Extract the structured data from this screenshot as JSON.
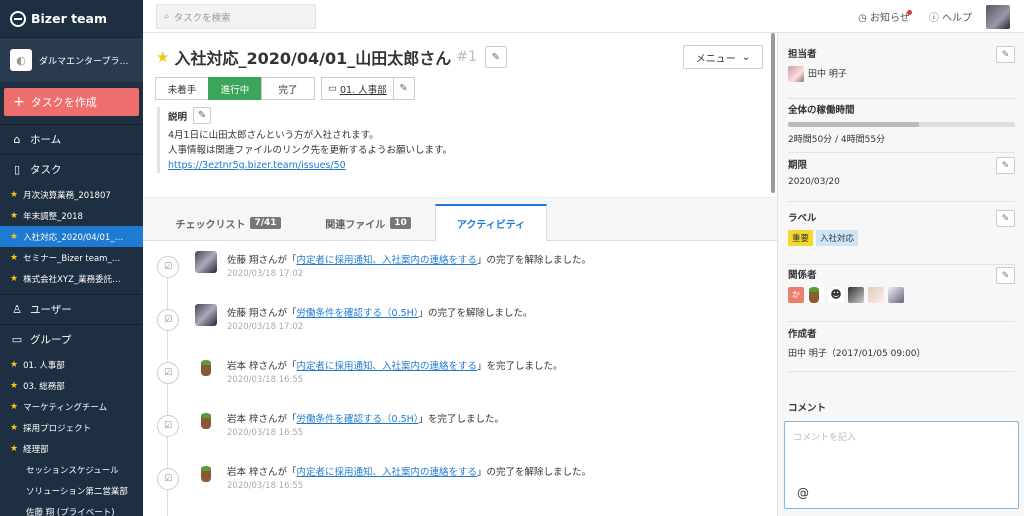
{
  "app": {
    "brand": "Bizer team",
    "org_name": "ダルマエンタープラ…"
  },
  "sidebar": {
    "create_label": "タスクを作成",
    "home_label": "ホーム",
    "tasks_label": "タスク",
    "tasks": [
      {
        "label": "月次決算業務_201807",
        "active": false
      },
      {
        "label": "年末調整_2018",
        "active": false
      },
      {
        "label": "入社対応_2020/04/01_…",
        "active": true
      },
      {
        "label": "セミナー_Bizer team_…",
        "active": false
      },
      {
        "label": "株式会社XYZ_業務委託…",
        "active": false
      }
    ],
    "users_label": "ユーザー",
    "groups_label": "グループ",
    "groups": [
      {
        "label": "01. 人事部",
        "starred": true
      },
      {
        "label": "03. 総務部",
        "starred": true
      },
      {
        "label": "マーケティングチーム",
        "starred": true
      },
      {
        "label": "採用プロジェクト",
        "starred": true
      },
      {
        "label": "経理部",
        "starred": true
      },
      {
        "label": "セッションスケジュール",
        "starred": false
      },
      {
        "label": "ソリューション第二営業部",
        "starred": false
      },
      {
        "label": "佐藤 翔 (プライベート)",
        "starred": false
      }
    ]
  },
  "topbar": {
    "search_placeholder": "タスクを検索",
    "notifications_label": "お知らせ",
    "help_label": "ヘルプ"
  },
  "task": {
    "title": "入社対応_2020/04/01_山田太郎さん",
    "number": "#1",
    "menu_label": "メニュー",
    "statuses": [
      "未着手",
      "進行中",
      "完了"
    ],
    "active_status": "進行中",
    "group": "01. 人事部",
    "description_label": "説明",
    "description_lines": [
      "4月1日に山田太郎さんという方が入社されます。",
      "人事情報は関連ファイルのリンク先を更新するようお願いします。"
    ],
    "description_link": "https://3eztnr5g.bizer.team/issues/50"
  },
  "tabs": [
    {
      "label": "チェックリスト",
      "badge": "7/41"
    },
    {
      "label": "関連ファイル",
      "badge": "10"
    },
    {
      "label": "アクティビティ",
      "badge": ""
    }
  ],
  "activities": [
    {
      "user": "佐藤 翔さんが「",
      "link": "内定者に採用通知、入社案内の連絡をする",
      "suffix": "」の完了を解除しました。",
      "time": "2020/03/18 17:02",
      "avatar": "sato"
    },
    {
      "user": "佐藤 翔さんが「",
      "link": "労働条件を確認する（0.5H）",
      "suffix": "」の完了を解除しました。",
      "time": "2020/03/18 17:02",
      "avatar": "sato"
    },
    {
      "user": "岩本 梓さんが「",
      "link": "内定者に採用通知、入社案内の連絡をする",
      "suffix": "」を完了しました。",
      "time": "2020/03/18 16:55",
      "avatar": "iwamoto"
    },
    {
      "user": "岩本 梓さんが「",
      "link": "労働条件を確認する（0.5H）",
      "suffix": "」を完了しました。",
      "time": "2020/03/18 16:55",
      "avatar": "iwamoto"
    },
    {
      "user": "岩本 梓さんが「",
      "link": "内定者に採用通知、入社案内の連絡をする",
      "suffix": "」の完了を解除しました。",
      "time": "2020/03/18 16:55",
      "avatar": "iwamoto"
    }
  ],
  "details": {
    "assignee_label": "担当者",
    "assignee": "田中 明子",
    "worktime_label": "全体の稼働時間",
    "worktime": "2時間50分 / 4時間55分",
    "worktime_ratio": 0.576,
    "deadline_label": "期限",
    "deadline": "2020/03/20",
    "label_label": "ラベル",
    "labels": [
      {
        "text": "重要",
        "bg": "#f5d82f",
        "fg": "#333"
      },
      {
        "text": "入社対応",
        "bg": "#cfe5f7",
        "fg": "#333"
      }
    ],
    "members_label": "関係者",
    "members_first_initial": "か",
    "creator_label": "作成者",
    "creator": "田中 明子（2017/01/05 09:00）",
    "comment_label": "コメント",
    "comment_placeholder": "コメントを記入",
    "comment_at": "@"
  }
}
